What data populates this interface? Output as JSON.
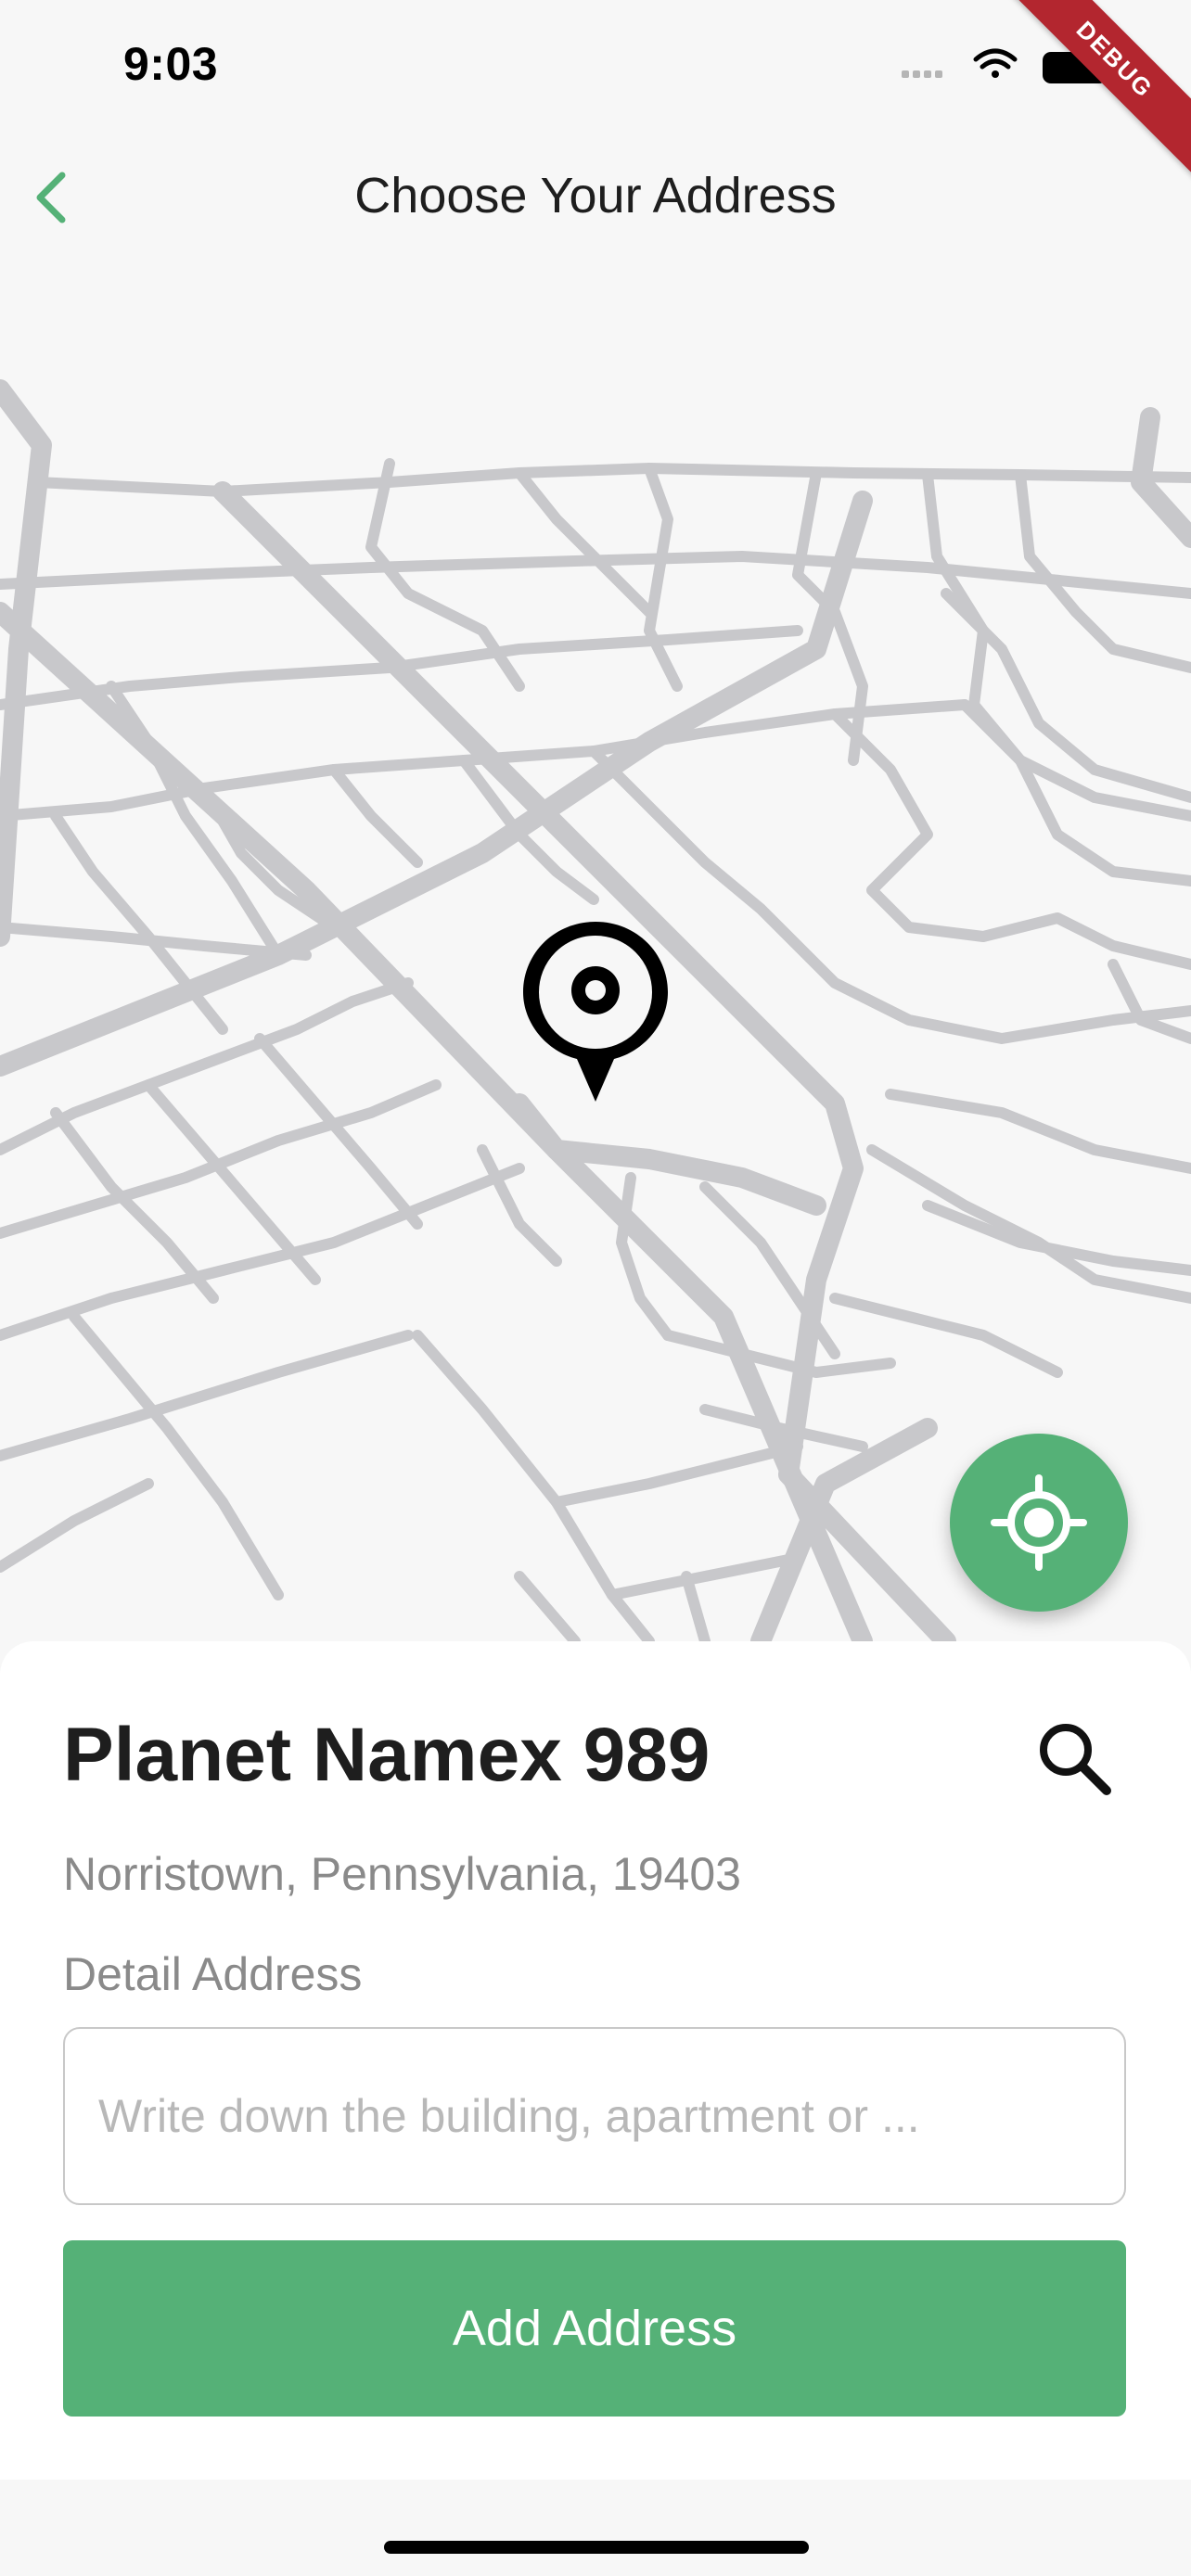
{
  "status_bar": {
    "time": "9:03",
    "icons": [
      "signal-icon",
      "wifi-icon",
      "battery-icon"
    ]
  },
  "debug_banner": "DEBUG",
  "header": {
    "title": "Choose Your Address",
    "back_icon": "chevron-left-icon"
  },
  "map": {
    "pin_icon": "location-pin-icon",
    "locate_icon": "my-location-icon"
  },
  "address_sheet": {
    "place_name": "Planet Namex 989",
    "address": "Norristown, Pennsylvania, 19403",
    "detail_label": "Detail Address",
    "detail_placeholder": "Write down the building, apartment or ...",
    "detail_value": "",
    "search_icon": "search-icon",
    "add_button_label": "Add Address"
  },
  "colors": {
    "accent": "#55b177",
    "title_text": "#1e1e1e",
    "muted_text": "#8a8a8a",
    "placeholder_text": "#b8b8b8",
    "map_road": "#c8c8cb",
    "map_background": "#f7f7f7",
    "sheet_background": "#ffffff",
    "debug_banner": "#b3262f"
  }
}
